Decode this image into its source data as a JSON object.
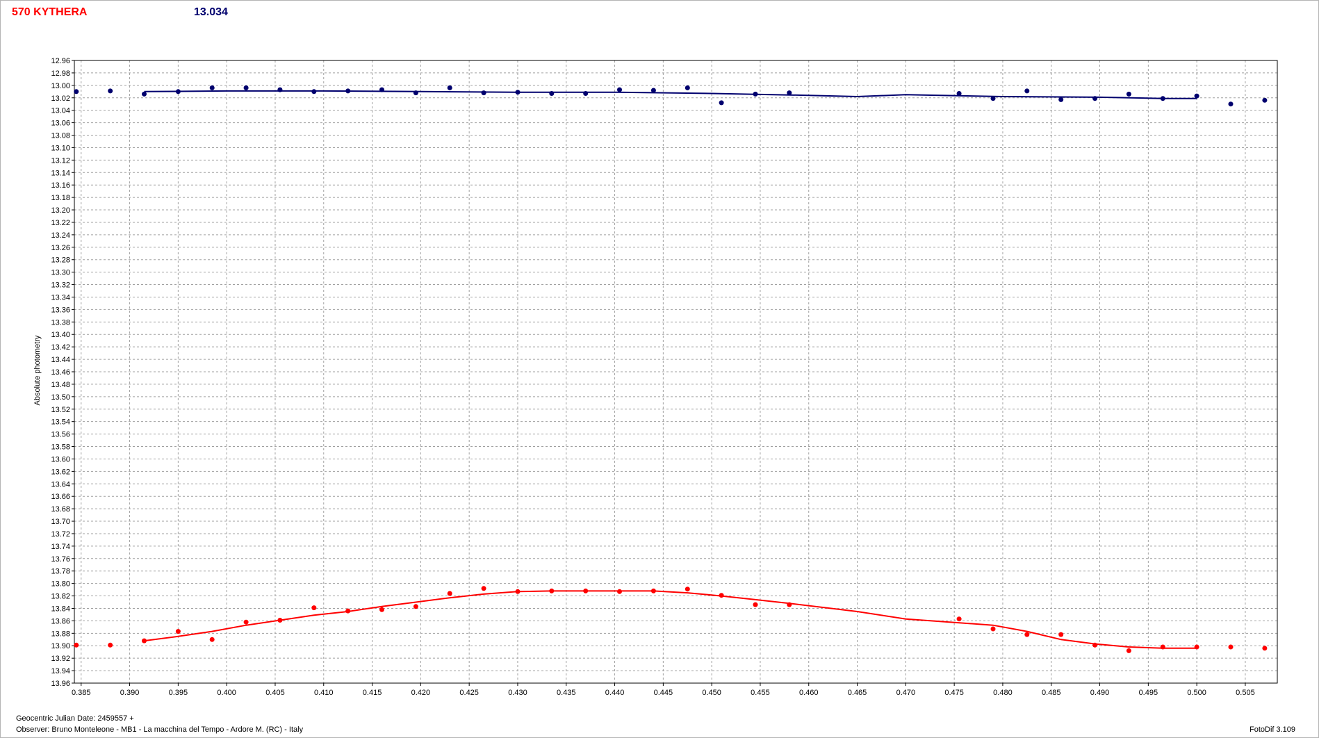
{
  "header": {
    "object_name": "570 KYTHERA",
    "magnitude": "13.034"
  },
  "footer": {
    "date_line": "Geocentric Julian Date: 2459557 +",
    "observer_line": "Observer: Bruno Monteleone - MB1 - La macchina del Tempo - Ardore M. (RC) - Italy",
    "software": "FotoDif 3.109"
  },
  "colors": {
    "series_top": "#00006e",
    "series_bottom": "#ff0000",
    "grid": "#a0a0a0",
    "title_object": "#ff0000",
    "title_magnitude": "#00006e"
  },
  "chart_data": {
    "type": "scatter",
    "title": "570 KYTHERA",
    "subtitle": "13.034",
    "xlabel": "Geocentric Julian Date: 2459557 +",
    "ylabel": "Absolute photometry",
    "xlim": [
      0.3843,
      0.5083
    ],
    "ylim": [
      12.96,
      13.96
    ],
    "y_inverted": true,
    "grid": true,
    "x_ticks": [
      "0.385",
      "0.390",
      "0.395",
      "0.400",
      "0.405",
      "0.410",
      "0.415",
      "0.420",
      "0.425",
      "0.430",
      "0.435",
      "0.440",
      "0.445",
      "0.450",
      "0.455",
      "0.460",
      "0.465",
      "0.470",
      "0.475",
      "0.480",
      "0.485",
      "0.490",
      "0.495",
      "0.500",
      "0.505"
    ],
    "y_ticks": [
      "12.96",
      "12.98",
      "13.00",
      "13.02",
      "13.04",
      "13.06",
      "13.08",
      "13.10",
      "13.12",
      "13.14",
      "13.16",
      "13.18",
      "13.20",
      "13.22",
      "13.24",
      "13.26",
      "13.28",
      "13.30",
      "13.32",
      "13.34",
      "13.36",
      "13.38",
      "13.40",
      "13.42",
      "13.44",
      "13.46",
      "13.48",
      "13.50",
      "13.52",
      "13.54",
      "13.56",
      "13.58",
      "13.60",
      "13.62",
      "13.64",
      "13.66",
      "13.68",
      "13.70",
      "13.72",
      "13.74",
      "13.76",
      "13.78",
      "13.80",
      "13.82",
      "13.84",
      "13.86",
      "13.88",
      "13.90",
      "13.92",
      "13.94",
      "13.96"
    ],
    "series": [
      {
        "color": "#00006e",
        "points": [
          [
            0.3845,
            13.01
          ],
          [
            0.388,
            13.009
          ],
          [
            0.3915,
            13.014
          ],
          [
            0.395,
            13.01
          ],
          [
            0.3985,
            13.004
          ],
          [
            0.402,
            13.004
          ],
          [
            0.4055,
            13.007
          ],
          [
            0.409,
            13.01
          ],
          [
            0.4125,
            13.009
          ],
          [
            0.416,
            13.007
          ],
          [
            0.4195,
            13.012
          ],
          [
            0.423,
            13.004
          ],
          [
            0.4265,
            13.012
          ],
          [
            0.43,
            13.011
          ],
          [
            0.4335,
            13.013
          ],
          [
            0.437,
            13.013
          ],
          [
            0.4405,
            13.007
          ],
          [
            0.444,
            13.008
          ],
          [
            0.4475,
            13.004
          ],
          [
            0.451,
            13.028
          ],
          [
            0.4545,
            13.014
          ],
          [
            0.458,
            13.012
          ],
          [
            0.4755,
            13.013
          ],
          [
            0.479,
            13.021
          ],
          [
            0.4825,
            13.009
          ],
          [
            0.486,
            13.023
          ],
          [
            0.4895,
            13.021
          ],
          [
            0.493,
            13.014
          ],
          [
            0.4965,
            13.021
          ],
          [
            0.5,
            13.017
          ],
          [
            0.5035,
            13.03
          ],
          [
            0.507,
            13.024
          ]
        ],
        "fit": [
          [
            0.3915,
            13.01
          ],
          [
            0.4,
            13.009
          ],
          [
            0.41,
            13.009
          ],
          [
            0.42,
            13.01
          ],
          [
            0.43,
            13.011
          ],
          [
            0.44,
            13.011
          ],
          [
            0.45,
            13.013
          ],
          [
            0.46,
            13.016
          ],
          [
            0.465,
            13.018
          ],
          [
            0.47,
            13.015
          ],
          [
            0.48,
            13.018
          ],
          [
            0.49,
            13.019
          ],
          [
            0.4965,
            13.021
          ],
          [
            0.5,
            13.021
          ]
        ]
      },
      {
        "color": "#ff0000",
        "points": [
          [
            0.3845,
            13.899
          ],
          [
            0.388,
            13.899
          ],
          [
            0.3915,
            13.892
          ],
          [
            0.395,
            13.877
          ],
          [
            0.3985,
            13.89
          ],
          [
            0.402,
            13.862
          ],
          [
            0.4055,
            13.859
          ],
          [
            0.409,
            13.839
          ],
          [
            0.4125,
            13.844
          ],
          [
            0.416,
            13.842
          ],
          [
            0.4195,
            13.837
          ],
          [
            0.423,
            13.816
          ],
          [
            0.4265,
            13.808
          ],
          [
            0.43,
            13.813
          ],
          [
            0.4335,
            13.812
          ],
          [
            0.437,
            13.812
          ],
          [
            0.4405,
            13.813
          ],
          [
            0.444,
            13.812
          ],
          [
            0.4475,
            13.809
          ],
          [
            0.451,
            13.819
          ],
          [
            0.4545,
            13.834
          ],
          [
            0.458,
            13.834
          ],
          [
            0.4755,
            13.857
          ],
          [
            0.479,
            13.873
          ],
          [
            0.4825,
            13.882
          ],
          [
            0.486,
            13.882
          ],
          [
            0.4895,
            13.899
          ],
          [
            0.493,
            13.908
          ],
          [
            0.4965,
            13.902
          ],
          [
            0.5,
            13.902
          ],
          [
            0.5035,
            13.902
          ],
          [
            0.507,
            13.904
          ]
        ],
        "fit": [
          [
            0.3915,
            13.892
          ],
          [
            0.395,
            13.885
          ],
          [
            0.3985,
            13.877
          ],
          [
            0.402,
            13.867
          ],
          [
            0.4055,
            13.859
          ],
          [
            0.409,
            13.851
          ],
          [
            0.4125,
            13.845
          ],
          [
            0.416,
            13.837
          ],
          [
            0.4195,
            13.83
          ],
          [
            0.423,
            13.823
          ],
          [
            0.4265,
            13.817
          ],
          [
            0.43,
            13.813
          ],
          [
            0.4335,
            13.812
          ],
          [
            0.437,
            13.812
          ],
          [
            0.4405,
            13.812
          ],
          [
            0.444,
            13.812
          ],
          [
            0.4475,
            13.815
          ],
          [
            0.451,
            13.82
          ],
          [
            0.4545,
            13.826
          ],
          [
            0.458,
            13.832
          ],
          [
            0.465,
            13.845
          ],
          [
            0.47,
            13.857
          ],
          [
            0.479,
            13.867
          ],
          [
            0.4825,
            13.877
          ],
          [
            0.486,
            13.89
          ],
          [
            0.4895,
            13.897
          ],
          [
            0.493,
            13.902
          ],
          [
            0.4965,
            13.904
          ],
          [
            0.5,
            13.904
          ]
        ]
      }
    ]
  }
}
